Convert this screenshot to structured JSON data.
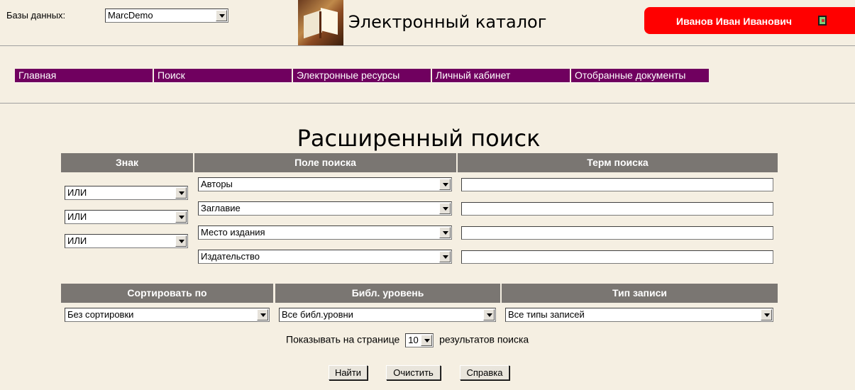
{
  "header": {
    "db_label": "Базы данных:",
    "db_selected": "MarcDemo",
    "app_title": "Электронный каталог",
    "user_name": "Иванов Иван Иванович"
  },
  "nav": {
    "items": [
      "Главная",
      "Поиск",
      "Электронные ресурсы",
      "Личный кабинет",
      "Отобранные документы"
    ]
  },
  "search": {
    "title": "Расширенный поиск",
    "columns": {
      "sign": "Знак",
      "field": "Поле поиска",
      "term": "Терм поиска"
    },
    "rows": [
      {
        "field": "Авторы",
        "term": ""
      },
      {
        "sign": "ИЛИ",
        "field": "Заглавие",
        "term": ""
      },
      {
        "sign": "ИЛИ",
        "field": "Место издания",
        "term": ""
      },
      {
        "sign": "ИЛИ",
        "field": "Издательство",
        "term": ""
      }
    ]
  },
  "options": {
    "headers": {
      "sort": "Сортировать по",
      "level": "Библ. уровень",
      "type": "Тип записи"
    },
    "sort_value": "Без сортировки",
    "level_value": "Все библ.уровни",
    "type_value": "Все типы записей",
    "per_page_prefix": "Показывать на странице",
    "per_page_value": "10",
    "per_page_suffix": "результатов поиска"
  },
  "buttons": {
    "find": "Найти",
    "clear": "Очистить",
    "help": "Справка"
  }
}
